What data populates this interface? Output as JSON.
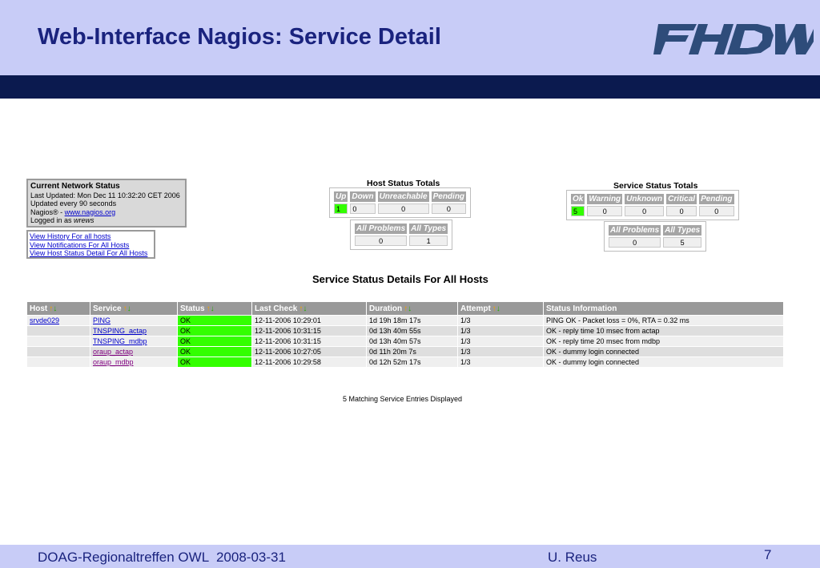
{
  "slide": {
    "title": "Web-Interface Nagios: Service Detail",
    "logo_text": "FHDW",
    "footer_left": "DOAG-Regionaltreffen OWL  2008-03-31",
    "footer_center": "U. Reus",
    "footer_right": "7"
  },
  "network_status": {
    "heading": "Current Network Status",
    "last_updated": "Last Updated: Mon Dec 11 10:32:20 CET 2006",
    "update_interval": "Updated every 90 seconds",
    "nagios_prefix": "Nagios® - ",
    "nagios_link": "www.nagios.org",
    "logged_in_prefix": "Logged in as ",
    "user": "wrews"
  },
  "links": [
    "View History For all hosts",
    "View Notifications For All Hosts",
    "View Host Status Detail For All Hosts"
  ],
  "host_totals": {
    "title": "Host Status Totals",
    "headers": [
      "Up",
      "Down",
      "Unreachable",
      "Pending"
    ],
    "values": [
      "1",
      "0",
      "0",
      "0"
    ],
    "sub_headers": [
      "All Problems",
      "All Types"
    ],
    "sub_values": [
      "0",
      "1"
    ]
  },
  "service_totals": {
    "title": "Service Status Totals",
    "headers": [
      "Ok",
      "Warning",
      "Unknown",
      "Critical",
      "Pending"
    ],
    "values": [
      "5",
      "0",
      "0",
      "0",
      "0"
    ],
    "sub_headers": [
      "All Problems",
      "All Types"
    ],
    "sub_values": [
      "0",
      "5"
    ]
  },
  "details": {
    "title": "Service Status Details For All Hosts",
    "columns": [
      "Host",
      "Service",
      "Status",
      "Last Check",
      "Duration",
      "Attempt",
      "Status Information"
    ],
    "rows": [
      {
        "host": "srvde029",
        "service": "PING",
        "status": "OK",
        "last_check": "12-11-2006 10:29:01",
        "duration": "1d 19h 18m 17s",
        "attempt": "1/3",
        "info": "PING OK - Packet loss = 0%, RTA = 0.32 ms"
      },
      {
        "host": "",
        "service": "TNSPING_actap",
        "status": "OK",
        "last_check": "12-11-2006 10:31:15",
        "duration": "0d 13h 40m 55s",
        "attempt": "1/3",
        "info": "OK - reply time 10 msec from actap"
      },
      {
        "host": "",
        "service": "TNSPING_mdbp",
        "status": "OK",
        "last_check": "12-11-2006 10:31:15",
        "duration": "0d 13h 40m 57s",
        "attempt": "1/3",
        "info": "OK - reply time 20 msec from mdbp"
      },
      {
        "host": "",
        "service": "oraup_actap",
        "status": "OK",
        "last_check": "12-11-2006 10:27:05",
        "duration": "0d 11h 20m 7s",
        "attempt": "1/3",
        "info": "OK - dummy login connected"
      },
      {
        "host": "",
        "service": "oraup_mdbp",
        "status": "OK",
        "last_check": "12-11-2006 10:29:58",
        "duration": "0d 12h 52m 17s",
        "attempt": "1/3",
        "info": "OK - dummy login connected"
      }
    ],
    "matching": "5 Matching Service Entries Displayed"
  },
  "colors": {
    "header_bg": "#c8ccf7",
    "bar": "#0b1a4f",
    "title": "#1a237e",
    "ok": "#33ff00",
    "table_header": "#999999"
  }
}
